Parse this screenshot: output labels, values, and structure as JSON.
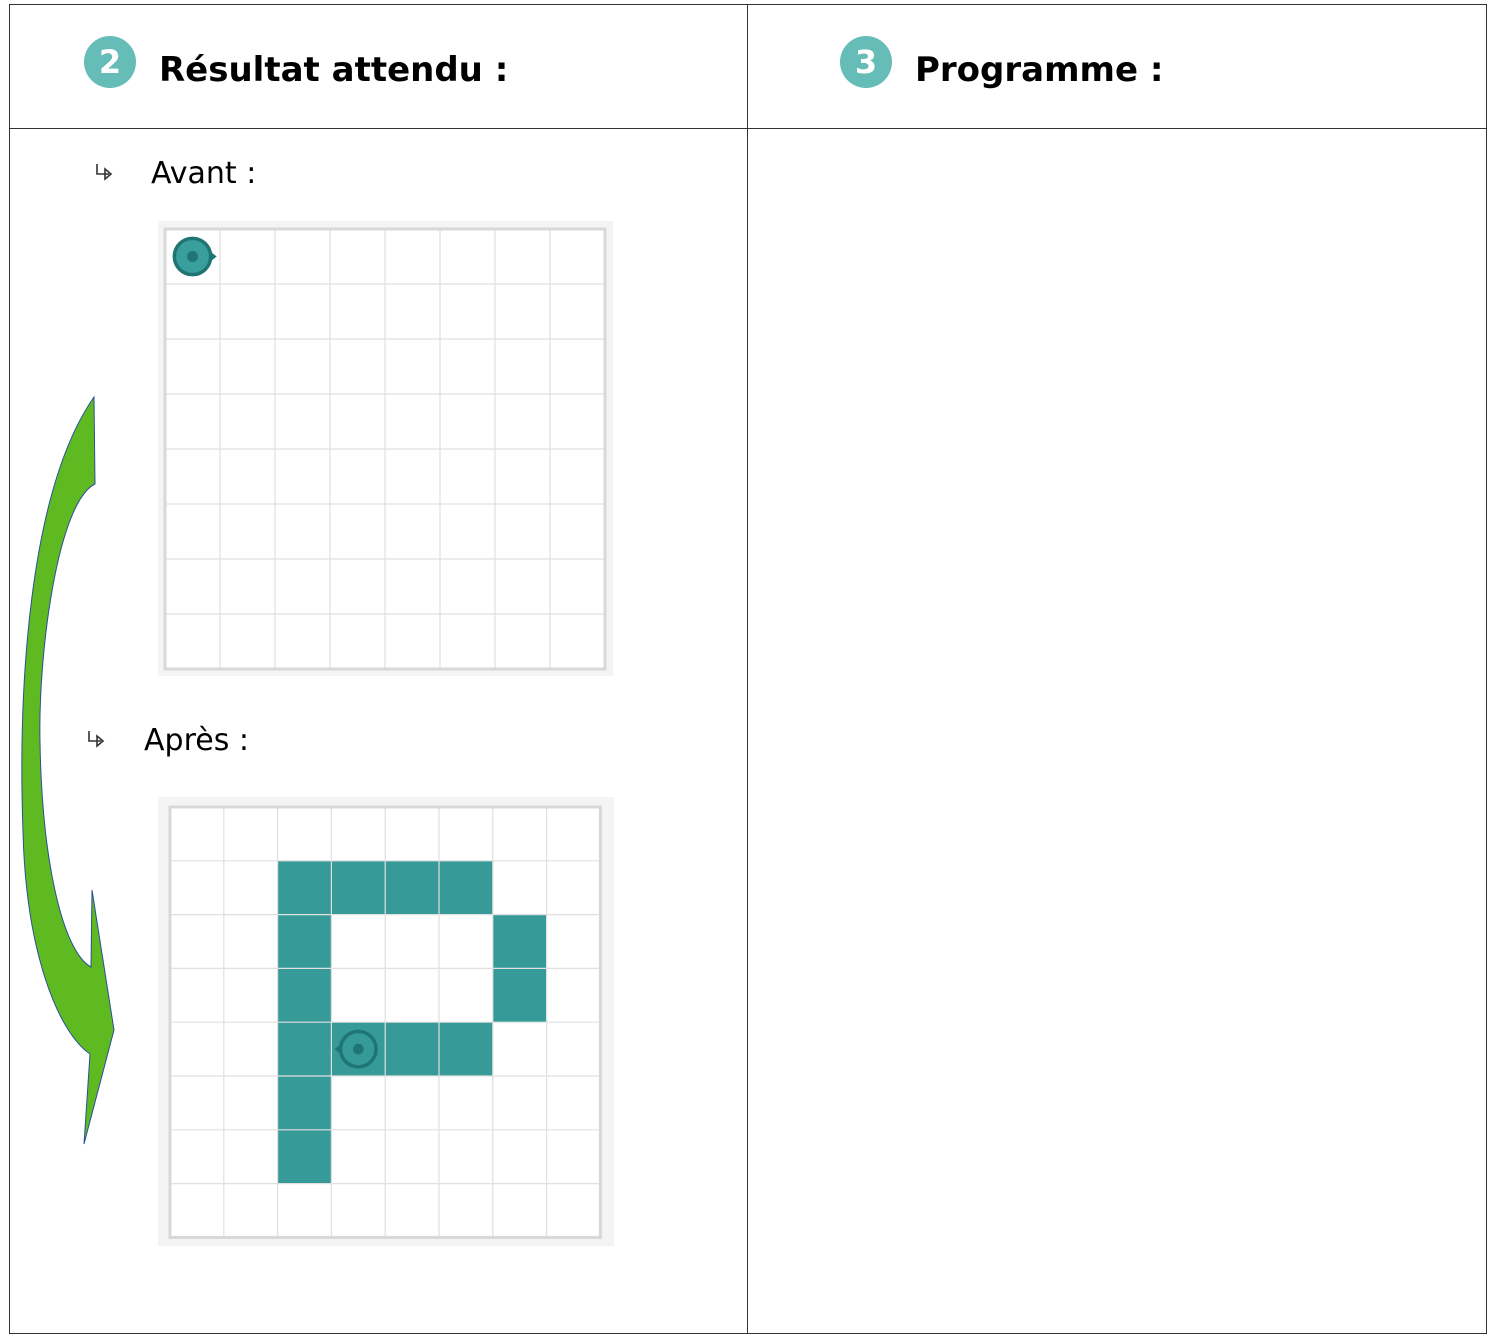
{
  "left_header": {
    "step_number": "2",
    "title": "Résultat attendu :"
  },
  "right_header": {
    "step_number": "3",
    "title": "Programme :"
  },
  "before": {
    "label": "Avant :",
    "bullet_icon": "arrow-curved-right-icon"
  },
  "after": {
    "label": "Après :",
    "bullet_icon": "arrow-curved-right-icon"
  },
  "grid": {
    "cols": 8,
    "rows": 8,
    "fill_color": "#359a98",
    "robot_color": "#1f7574",
    "line_color": "#e0e0e0",
    "border_color": "#d8d8d8"
  },
  "before_state": {
    "robot": {
      "col": 0,
      "row": 0,
      "facing": "right"
    },
    "filled": []
  },
  "after_state": {
    "robot": {
      "col": 3,
      "row": 4,
      "facing": "left"
    },
    "filled": [
      [
        2,
        1
      ],
      [
        3,
        1
      ],
      [
        4,
        1
      ],
      [
        5,
        1
      ],
      [
        2,
        2
      ],
      [
        6,
        2
      ],
      [
        2,
        3
      ],
      [
        6,
        3
      ],
      [
        2,
        4
      ],
      [
        3,
        4
      ],
      [
        4,
        4
      ],
      [
        5,
        4
      ],
      [
        2,
        5
      ],
      [
        2,
        6
      ]
    ]
  },
  "arrow_color": "#5fba22"
}
